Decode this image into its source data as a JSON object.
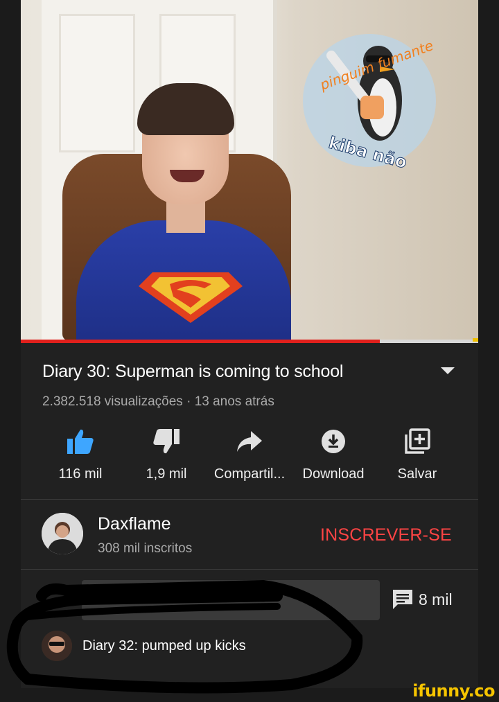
{
  "video": {
    "progress_fraction": 0.785,
    "sticker_text_top": "pinguim fumante",
    "sticker_text_bottom": "kiba não"
  },
  "title": "Diary 30: Superman is coming to school",
  "meta": "2.382.518 visualizações · 13 anos atrás",
  "actions": [
    {
      "icon": "thumbs-up-icon",
      "label": "116 mil",
      "color": "#3ea6ff"
    },
    {
      "icon": "thumbs-down-icon",
      "label": "1,9 mil"
    },
    {
      "icon": "share-icon",
      "label": "Compartil..."
    },
    {
      "icon": "download-icon",
      "label": "Download"
    },
    {
      "icon": "save-to-playlist-icon",
      "label": "Salvar"
    }
  ],
  "channel": {
    "name": "Daxflame",
    "subscribers": "308 mil inscritos",
    "subscribe_label": "INSCREVER-SE",
    "subscribe_color": "#ff4444"
  },
  "comments": {
    "count": "8 mil",
    "icon": "comment-icon"
  },
  "next_video": {
    "title": "Diary 32: pumped up kicks"
  },
  "watermark": "ifunny.co"
}
